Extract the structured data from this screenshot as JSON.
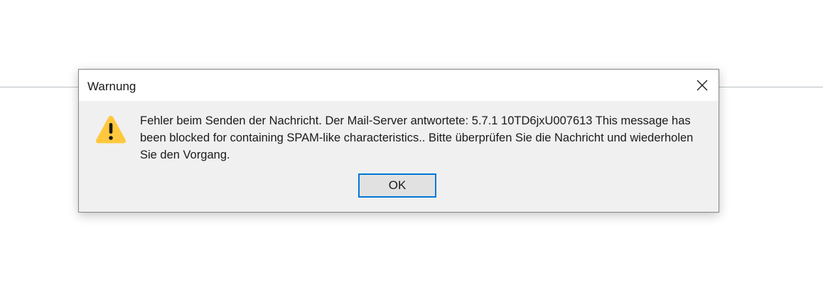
{
  "dialog": {
    "title": "Warnung",
    "icon": "warning-icon",
    "message": "Fehler beim Senden der Nachricht. Der Mail-Server antwortete:  5.7.1 10TD6jxU007613 This message has been blocked for containing SPAM-like characteristics.. Bitte überprüfen Sie die Nachricht und wiederholen Sie den Vorgang.",
    "ok_label": "OK",
    "accent_color": "#0078d7",
    "warning_color": "#ffc83d"
  }
}
